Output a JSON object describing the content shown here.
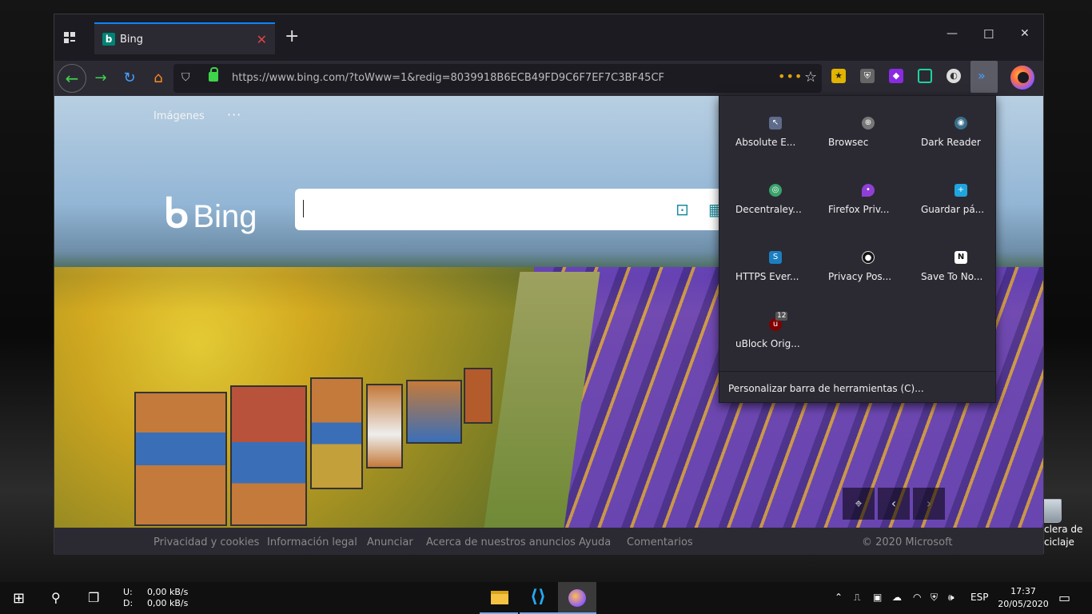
{
  "browser": {
    "tab_title": "Bing",
    "tab_favicon": "b",
    "url": "https://www.bing.com/?toWww=1&redig=8039918B6ECB49FD9C6F7EF7C3BF45CF",
    "accent": "#0a84ff",
    "icons": {
      "apps": "apps-grid-icon",
      "back": "back-arrow-icon",
      "forward": "forward-arrow-icon",
      "reload": "reload-icon",
      "home": "home-icon",
      "shield": "shield-icon",
      "lock": "lock-icon",
      "page_actions": "more-dots-icon",
      "bookmark": "star-icon",
      "overflow": "chevron-double-icon",
      "firefox": "firefox-account-icon"
    }
  },
  "bing": {
    "nav_link": "Imágenes",
    "nav_more": "···",
    "logo_text": "Bing",
    "footer": [
      "Privacidad y cookies",
      "Información legal",
      "Anunciar",
      "Acerca de nuestros anuncios",
      "Ayuda",
      "Comentarios"
    ],
    "copyright": "© 2020 Microsoft"
  },
  "overflow_panel": {
    "items": [
      {
        "label": "Absolute E...",
        "icon": "cursor-icon",
        "color": "#5f6b8a"
      },
      {
        "label": "Browsec",
        "icon": "globe-icon",
        "color": "#777"
      },
      {
        "label": "Dark Reader",
        "icon": "dark-reader-icon",
        "color": "#3a6e8a"
      },
      {
        "label": "Decentraley...",
        "icon": "decentraleyes-icon",
        "color": "#3aa36b"
      },
      {
        "label": "Firefox Priv...",
        "icon": "location-pin-icon",
        "color": "#8f3fd6"
      },
      {
        "label": "Guardar pá...",
        "icon": "save-page-icon",
        "color": "#1fa5e0"
      },
      {
        "label": "HTTPS Ever...",
        "icon": "https-everywhere-icon",
        "color": "#1a7fc1"
      },
      {
        "label": "Privacy Pos...",
        "icon": "privacy-possum-icon",
        "color": "#222"
      },
      {
        "label": "Save To No...",
        "icon": "notion-icon",
        "color": "#fff"
      },
      {
        "label": "uBlock Orig...",
        "icon": "ublock-icon",
        "color": "#800000",
        "badge": "12"
      }
    ],
    "customize": "Personalizar barra de herramientas (C)..."
  },
  "desktop": {
    "recycle_bin_label_1": "clera de",
    "recycle_bin_label_2": "ciclaje"
  },
  "taskbar": {
    "net_up_label": "U:",
    "net_up_value": "0,00 kB/s",
    "net_down_label": "D:",
    "net_down_value": "0,00 kB/s",
    "language": "ESP",
    "time": "17:37",
    "date": "20/05/2020"
  }
}
